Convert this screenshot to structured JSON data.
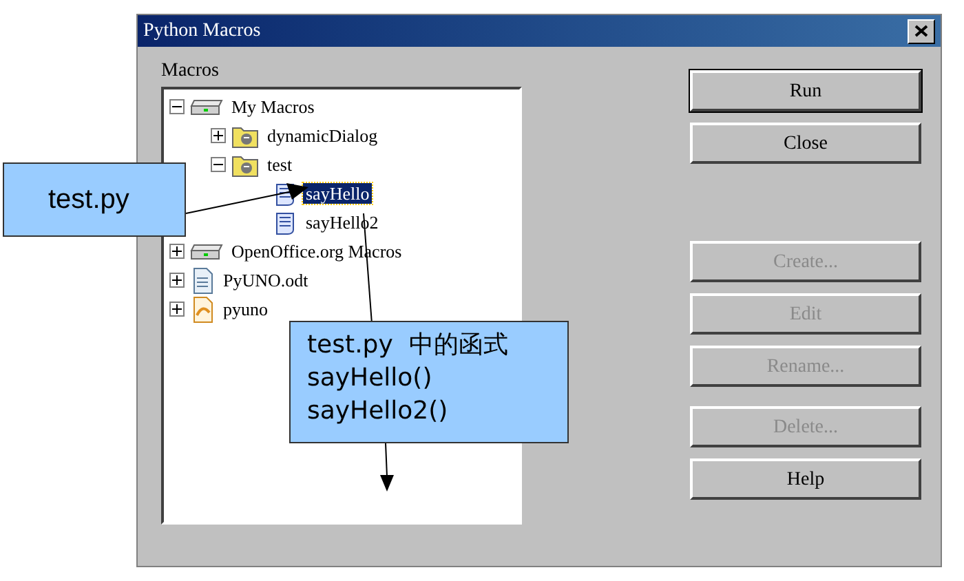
{
  "window": {
    "title": "Python Macros"
  },
  "tree_label": "Macros",
  "tree": [
    {
      "label": "My Macros",
      "kind": "library",
      "expanded": true,
      "selected": false,
      "children": [
        {
          "label": "dynamicDialog",
          "kind": "folder",
          "expanded": false,
          "selected": false
        },
        {
          "label": "test",
          "kind": "folder",
          "expanded": true,
          "selected": false,
          "children": [
            {
              "label": "sayHello",
              "kind": "script",
              "selected": true
            },
            {
              "label": "sayHello2",
              "kind": "script",
              "selected": false
            }
          ]
        }
      ]
    },
    {
      "label": "OpenOffice.org Macros",
      "kind": "library",
      "expanded": false,
      "selected": false
    },
    {
      "label": "PyUNO.odt",
      "kind": "document",
      "expanded": false,
      "selected": false
    },
    {
      "label": "pyuno",
      "kind": "drawing",
      "expanded": false,
      "selected": false
    }
  ],
  "buttons": [
    {
      "label": "Run",
      "disabled": false,
      "default": true
    },
    {
      "label": "Close",
      "disabled": false,
      "default": false
    },
    {
      "label": "Create...",
      "disabled": true,
      "default": false
    },
    {
      "label": "Edit",
      "disabled": true,
      "default": false
    },
    {
      "label": "Rename...",
      "disabled": true,
      "default": false
    },
    {
      "label": "Delete...",
      "disabled": true,
      "default": false
    },
    {
      "label": "Help",
      "disabled": false,
      "default": false
    }
  ],
  "callouts": [
    {
      "lines": [
        "test.py"
      ]
    },
    {
      "lines": [
        "test.py  中的函式",
        "sayHello()",
        "sayHello2()"
      ]
    }
  ]
}
